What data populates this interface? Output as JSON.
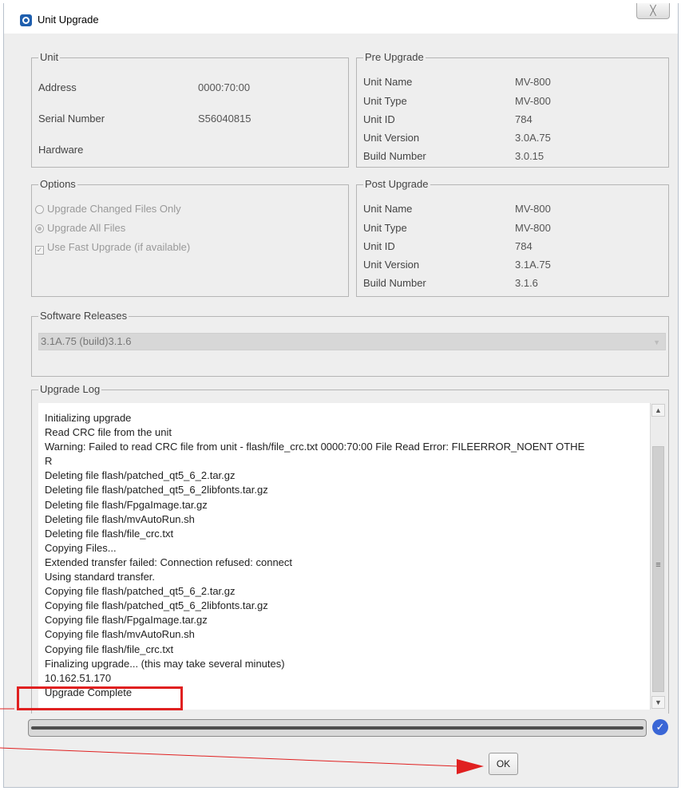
{
  "window": {
    "title": "Unit Upgrade",
    "close_label": "╳"
  },
  "unit": {
    "legend": "Unit",
    "rows": [
      {
        "label": "Address",
        "value": "0000:70:00"
      },
      {
        "label": "Serial Number",
        "value": "S56040815"
      },
      {
        "label": "Hardware",
        "value": ""
      }
    ]
  },
  "pre_upgrade": {
    "legend": "Pre Upgrade",
    "rows": [
      {
        "label": "Unit Name",
        "value": "MV-800"
      },
      {
        "label": "Unit Type",
        "value": "MV-800"
      },
      {
        "label": "Unit ID",
        "value": "784"
      },
      {
        "label": "Unit Version",
        "value": "3.0A.75"
      },
      {
        "label": "Build Number",
        "value": "3.0.15"
      }
    ]
  },
  "options": {
    "legend": "Options",
    "changed_only_label": "Upgrade Changed Files Only",
    "all_files_label": "Upgrade All Files",
    "fast_upgrade_label": "Use Fast Upgrade (if available)",
    "selected": "all_files",
    "fast_upgrade_checked": true
  },
  "post_upgrade": {
    "legend": "Post Upgrade",
    "rows": [
      {
        "label": "Unit Name",
        "value": "MV-800"
      },
      {
        "label": "Unit Type",
        "value": "MV-800"
      },
      {
        "label": "Unit ID",
        "value": "784"
      },
      {
        "label": "Unit Version",
        "value": "3.1A.75"
      },
      {
        "label": "Build Number",
        "value": "3.1.6"
      }
    ]
  },
  "software_releases": {
    "legend": "Software Releases",
    "selected": "3.1A.75 (build)3.1.6"
  },
  "upgrade_log": {
    "legend": "Upgrade Log",
    "lines": [
      "Initializing upgrade",
      "Read CRC file from the unit",
      "Warning: Failed to read CRC file from unit - flash/file_crc.txt  0000:70:00 File Read Error: FILEERROR_NOENT OTHE",
      "R",
      "Deleting file flash/patched_qt5_6_2.tar.gz",
      "Deleting file flash/patched_qt5_6_2libfonts.tar.gz",
      "Deleting file flash/FpgaImage.tar.gz",
      "Deleting file flash/mvAutoRun.sh",
      "Deleting file flash/file_crc.txt",
      "Copying Files...",
      "Extended transfer failed: Connection refused: connect",
      "Using standard transfer.",
      "Copying file flash/patched_qt5_6_2.tar.gz",
      "Copying file flash/patched_qt5_6_2libfonts.tar.gz",
      "Copying file flash/FpgaImage.tar.gz",
      "Copying file flash/mvAutoRun.sh",
      "Copying file flash/file_crc.txt",
      "Finalizing upgrade... (this may take several minutes)",
      "10.162.51.170",
      "Upgrade Complete"
    ]
  },
  "progress": {
    "fraction": 1.0
  },
  "buttons": {
    "ok_label": "OK"
  },
  "colors": {
    "annotation": "#e02020",
    "check_icon": "#3a66d6"
  },
  "icons": {
    "status": "check-circle-icon",
    "app": "app-logo-icon"
  }
}
